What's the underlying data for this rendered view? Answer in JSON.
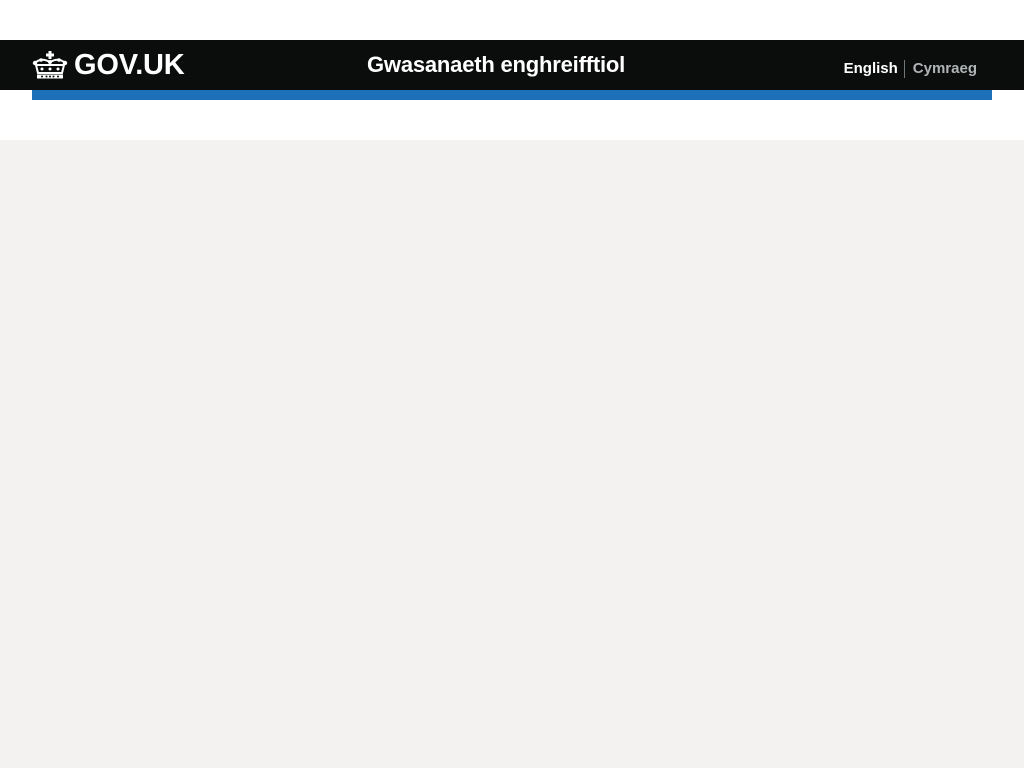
{
  "header": {
    "logo_text": "GOV.UK",
    "logo_icon": "crown-icon",
    "service_name": "Gwasanaeth enghreifftiol",
    "language": {
      "current": "English",
      "alternate": "Cymraeg"
    }
  },
  "colors": {
    "header_bg": "#0b0c0c",
    "brand_bar": "#1d70b8",
    "page_bg": "#f3f2f1",
    "link_muted": "#b1b4b6"
  }
}
